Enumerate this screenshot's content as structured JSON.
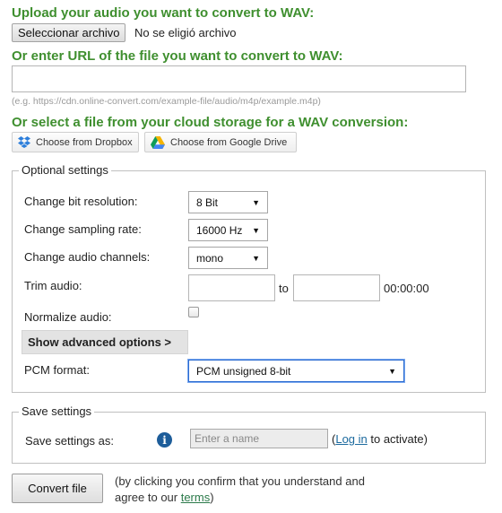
{
  "upload": {
    "heading": "Upload your audio you want to convert to WAV:",
    "choose_button": "Seleccionar archivo",
    "no_file_text": "No se eligió archivo"
  },
  "url": {
    "heading": "Or enter URL of the file you want to convert to WAV:",
    "value": "",
    "hint": "(e.g. https://cdn.online-convert.com/example-file/audio/m4p/example.m4p)"
  },
  "cloud": {
    "heading": "Or select a file from your cloud storage for a WAV conversion:",
    "dropbox_label": "Choose from Dropbox",
    "gdrive_label": "Choose from Google Drive",
    "dropbox_color": "#2d7fdb"
  },
  "optional": {
    "legend": "Optional settings",
    "bit_resolution": {
      "label": "Change bit resolution:",
      "value": "8 Bit"
    },
    "sampling_rate": {
      "label": "Change sampling rate:",
      "value": "16000 Hz"
    },
    "channels": {
      "label": "Change audio channels:",
      "value": "mono"
    },
    "trim": {
      "label": "Trim audio:",
      "from": "",
      "to_label": "to",
      "to": "",
      "duration": "00:00:00"
    },
    "normalize": {
      "label": "Normalize audio:",
      "checked": false
    },
    "advanced_button": "Show advanced options >",
    "pcm": {
      "label": "PCM format:",
      "value": "PCM unsigned 8-bit"
    }
  },
  "save": {
    "legend": "Save settings",
    "label": "Save settings as:",
    "placeholder": "Enter a name",
    "paren_open": "(",
    "login_link": "Log in",
    "activate_text": " to activate)"
  },
  "convert": {
    "button": "Convert file",
    "note_line1": "(by clicking you confirm that you understand and",
    "note_prefix": "agree to our ",
    "terms_link": "terms",
    "note_suffix": ")"
  },
  "colors": {
    "heading_green": "#3f8f2f",
    "focus_blue": "#2b6bd1",
    "info_blue": "#1d5d9a"
  },
  "icons": {
    "dropbox": "dropbox-icon",
    "gdrive": "google-drive-icon",
    "info": "info-icon",
    "dropdown": "dropdown-arrow-icon"
  }
}
